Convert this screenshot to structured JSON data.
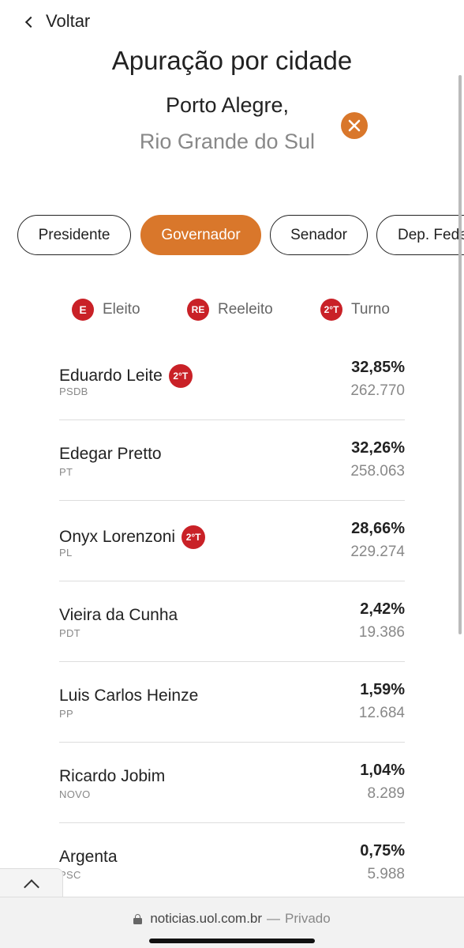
{
  "header": {
    "back_label": "Voltar",
    "title": "Apuração por cidade",
    "city": "Porto Alegre,",
    "state": "Rio Grande do Sul"
  },
  "tabs": [
    {
      "label": "Presidente",
      "active": false
    },
    {
      "label": "Governador",
      "active": true
    },
    {
      "label": "Senador",
      "active": false
    },
    {
      "label": "Dep. Federal",
      "active": false
    }
  ],
  "legend": [
    {
      "badge": "E",
      "label": "Eleito"
    },
    {
      "badge": "RE",
      "label": "Reeleito"
    },
    {
      "badge": "2°T",
      "label": "Turno"
    }
  ],
  "candidates": [
    {
      "name": "Eduardo Leite",
      "party": "PSDB",
      "pct": "32,85%",
      "votes": "262.770",
      "badge": "2°T"
    },
    {
      "name": "Edegar Pretto",
      "party": "PT",
      "pct": "32,26%",
      "votes": "258.063",
      "badge": ""
    },
    {
      "name": "Onyx Lorenzoni",
      "party": "PL",
      "pct": "28,66%",
      "votes": "229.274",
      "badge": "2°T"
    },
    {
      "name": "Vieira da Cunha",
      "party": "PDT",
      "pct": "2,42%",
      "votes": "19.386",
      "badge": ""
    },
    {
      "name": "Luis Carlos Heinze",
      "party": "PP",
      "pct": "1,59%",
      "votes": "12.684",
      "badge": ""
    },
    {
      "name": "Ricardo Jobim",
      "party": "NOVO",
      "pct": "1,04%",
      "votes": "8.289",
      "badge": ""
    },
    {
      "name": "Argenta",
      "party": "PSC",
      "pct": "0,75%",
      "votes": "5.988",
      "badge": ""
    }
  ],
  "browser": {
    "url": "noticias.uol.com.br",
    "separator": "—",
    "mode": "Privado"
  },
  "colors": {
    "accent": "#d9772b",
    "badge_red": "#c92127"
  },
  "icons": {
    "back": "chevron-left-icon",
    "clear": "close-icon",
    "scroll_top": "chevron-up-icon",
    "lock": "lock-icon"
  }
}
